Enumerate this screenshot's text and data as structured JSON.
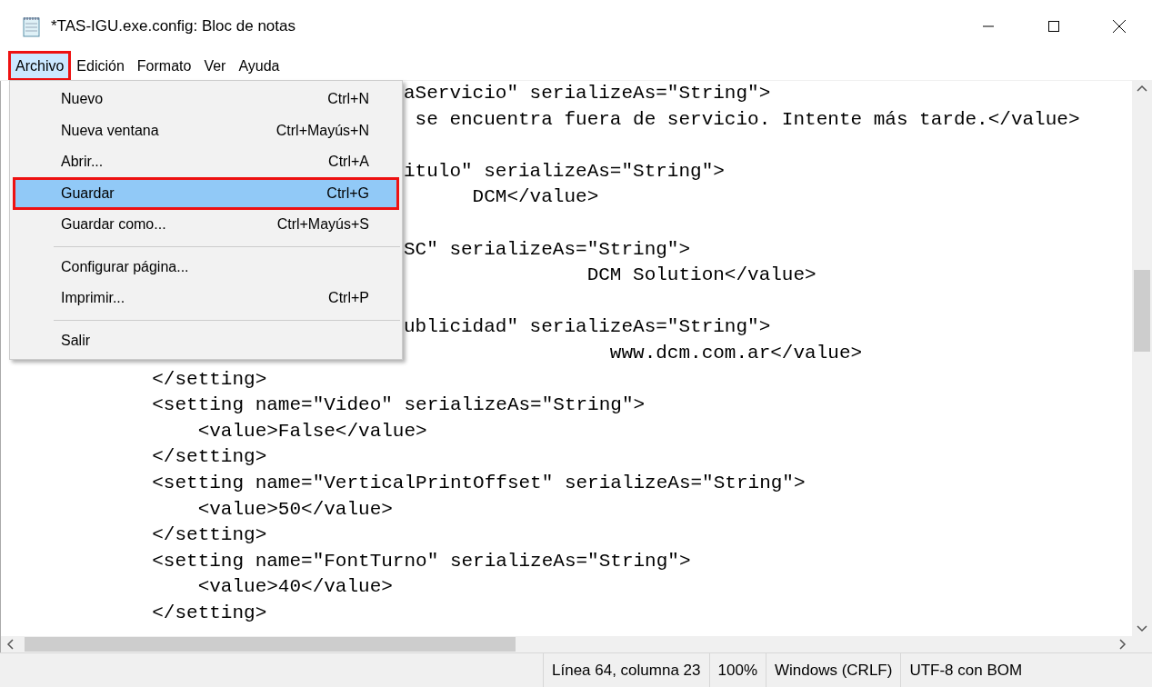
{
  "window": {
    "title": "*TAS-IGU.exe.config: Bloc de notas"
  },
  "menubar": [
    {
      "label": "Archivo",
      "selected": true,
      "highlighted": true
    },
    {
      "label": "Edición",
      "selected": false,
      "highlighted": false
    },
    {
      "label": "Formato",
      "selected": false,
      "highlighted": false
    },
    {
      "label": "Ver",
      "selected": false,
      "highlighted": false
    },
    {
      "label": "Ayuda",
      "selected": false,
      "highlighted": false
    }
  ],
  "menu": [
    {
      "kind": "item",
      "label": "Nuevo",
      "shortcut": "Ctrl+N",
      "selected": false,
      "highlighted": false
    },
    {
      "kind": "item",
      "label": "Nueva ventana",
      "shortcut": "Ctrl+Mayús+N",
      "selected": false,
      "highlighted": false
    },
    {
      "kind": "item",
      "label": "Abrir...",
      "shortcut": "Ctrl+A",
      "selected": false,
      "highlighted": false
    },
    {
      "kind": "item",
      "label": "Guardar",
      "shortcut": "Ctrl+G",
      "selected": true,
      "highlighted": true
    },
    {
      "kind": "item",
      "label": "Guardar como...",
      "shortcut": "Ctrl+Mayús+S",
      "selected": false,
      "highlighted": false
    },
    {
      "kind": "separator"
    },
    {
      "kind": "item",
      "label": "Configurar página...",
      "selected": false,
      "highlighted": false
    },
    {
      "kind": "item",
      "label": "Imprimir...",
      "shortcut": "Ctrl+P",
      "selected": false,
      "highlighted": false
    },
    {
      "kind": "separator"
    },
    {
      "kind": "item",
      "label": "Salir",
      "selected": false,
      "highlighted": false
    }
  ],
  "editor": {
    "lines": [
      {
        "kind": "partial",
        "text": "aServicio\" serializeAs=\"String\">"
      },
      {
        "kind": "partial",
        "text": " se encuentra fuera de servicio. Intente más tarde.</value>"
      },
      {
        "kind": "blank"
      },
      {
        "kind": "partial",
        "text": "itulo\" serializeAs=\"String\">"
      },
      {
        "kind": "partial",
        "text": "      DCM</value>"
      },
      {
        "kind": "blank"
      },
      {
        "kind": "partial",
        "text": "SC\" serializeAs=\"String\">"
      },
      {
        "kind": "partial",
        "text": "                DCM Solution</value>"
      },
      {
        "kind": "blank"
      },
      {
        "kind": "partial",
        "text": "ublicidad\" serializeAs=\"String\">"
      },
      {
        "kind": "partial",
        "text": "                  www.dcm.com.ar</value>"
      },
      {
        "kind": "full",
        "text": "            </setting>"
      },
      {
        "kind": "full",
        "text": "            <setting name=\"Video\" serializeAs=\"String\">"
      },
      {
        "kind": "full",
        "text": "                <value>False</value>"
      },
      {
        "kind": "full",
        "text": "            </setting>"
      },
      {
        "kind": "full",
        "text": "            <setting name=\"VerticalPrintOffset\" serializeAs=\"String\">"
      },
      {
        "kind": "full",
        "text": "                <value>50</value>"
      },
      {
        "kind": "full",
        "text": "            </setting>"
      },
      {
        "kind": "full",
        "text": "            <setting name=\"FontTurno\" serializeAs=\"String\">"
      },
      {
        "kind": "full",
        "text": "                <value>40</value>"
      },
      {
        "kind": "full",
        "text": "            </setting>"
      }
    ]
  },
  "status_bar": [
    "Línea 64, columna 23",
    "100%",
    "Windows (CRLF)",
    "UTF-8 con BOM"
  ]
}
